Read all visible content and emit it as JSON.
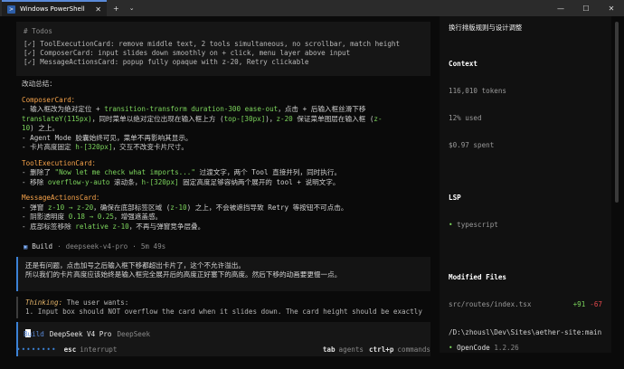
{
  "window": {
    "tab_title": "Windows PowerShell",
    "close_glyph": "✕",
    "new_tab_glyph": "+",
    "dropdown_glyph": "⌄",
    "minimize_glyph": "—",
    "maximize_glyph": "☐",
    "window_close_glyph": "✕"
  },
  "todos": {
    "header": "# Todos",
    "items": [
      "[✓] ToolExecutionCard: remove middle text, 2 tools simultaneous, no scrollbar, match height",
      "[✓] ComposerCard: input slides down smoothly on + click, menu layer above input",
      "[✓] MessageActionsCard: popup fully opaque with z-20, Retry clickable"
    ]
  },
  "summary": {
    "heading": "改动总结：",
    "composer_title": "ComposerCard：",
    "composer_l1a": "- 输入框改为绝对定位 + ",
    "composer_l1b": "transition-transform duration-300 ease-out",
    "composer_l1c": "，点击 + 后输入框丝滑下移",
    "composer_l2a": "translateY(115px)",
    "composer_l2b": "，同时菜单以绝对定位出现在输入框上方 (",
    "composer_l2c": "top-[30px]",
    "composer_l2d": ")，",
    "composer_l2e": "z-20",
    "composer_l2f": " 保证菜单图层在输入框 (",
    "composer_l2g": "z-",
    "composer_l3a": "10",
    "composer_l3b": ") 之上。",
    "composer_l4": "- Agent Mode 胶囊始终可见，菜单不再影响其显示。",
    "composer_l5a": "- 卡片高度固定 ",
    "composer_l5b": "h-[320px]",
    "composer_l5c": "，交互不改变卡片尺寸。",
    "tool_title": "ToolExecutionCard：",
    "tool_l1a": "- 删除了 ",
    "tool_l1b": "\"Now let me check what imports...\"",
    "tool_l1c": " 过渡文字，两个 Tool 直接并列，同时执行。",
    "tool_l2a": "- 移除 ",
    "tool_l2b": "overflow-y-auto",
    "tool_l2c": " 滚动条，",
    "tool_l2d": "h-[320px]",
    "tool_l2e": " 固定高度足够容纳两个展开的 ",
    "tool_l2f": "tool + 说明文字。",
    "msg_title": "MessageActionsCard：",
    "msg_l1a": "- 弹窗 ",
    "msg_l1b": "z-10 → z-20",
    "msg_l1c": "，确保在底部标签区域 (",
    "msg_l1d": "z-10",
    "msg_l1e": ") 之上，不会被遮挡导致 Retry 等按钮不可点击。",
    "msg_l2a": "- 阴影透明度 ",
    "msg_l2b": "0.18 → 0.25",
    "msg_l2c": "，增强遮盖感。",
    "msg_l3a": "- 底部标签移除 ",
    "msg_l3b": "relative z-10",
    "msg_l3c": "，不再与弹窗竞争层叠。"
  },
  "build_meta": {
    "mode": "Build",
    "sep1": "·",
    "model": "deepseek-v4-pro",
    "sep2": "·",
    "duration": "5m 49s"
  },
  "user_message": {
    "line1": "还是有问题，点击加号之后输入框下移都超出卡片了，这个不允许溢出。",
    "line2": "所以我们的卡片高度应该始终是输入框完全展开后的高度正好塞下的高度。然后下移的动画要更慢一点。"
  },
  "thinking": {
    "label": "Thinking:",
    "text": " The user wants:",
    "line2": "1. Input box should NOT overflow the card when it slides down. The card height should be exactly"
  },
  "composer": {
    "mode": "Build",
    "model": "DeepSeek V4 Pro",
    "provider": "DeepSeek"
  },
  "statusbar": {
    "dots": "••••••••",
    "esc_key": "esc",
    "esc_hint": "interrupt",
    "tab_key": "tab",
    "tab_hint": "agents",
    "ctrlp_key": "ctrl+p",
    "ctrlp_hint": "commands"
  },
  "sidebar": {
    "title": "换行排版规则与设计调整",
    "context_h": "Context",
    "tokens": "116,010 tokens",
    "used": "12% used",
    "spent": "$0.97 spent",
    "lsp_h": "LSP",
    "lsp_dot": "•",
    "lsp_item": "typescript",
    "files_h": "Modified Files",
    "file_name": "src/routes/index.tsx",
    "file_add": "+91",
    "file_del": "-67",
    "path": "/D:\\zhousl\\Dev\\Sites\\aether-site:main",
    "brand_dot": "•",
    "brand_name": "OpenCode",
    "brand_ver": "1.2.26"
  },
  "colors": {
    "accent": "#3b82d6",
    "orange": "#f5a24a",
    "green": "#7cd45c",
    "red": "#e5484d"
  }
}
